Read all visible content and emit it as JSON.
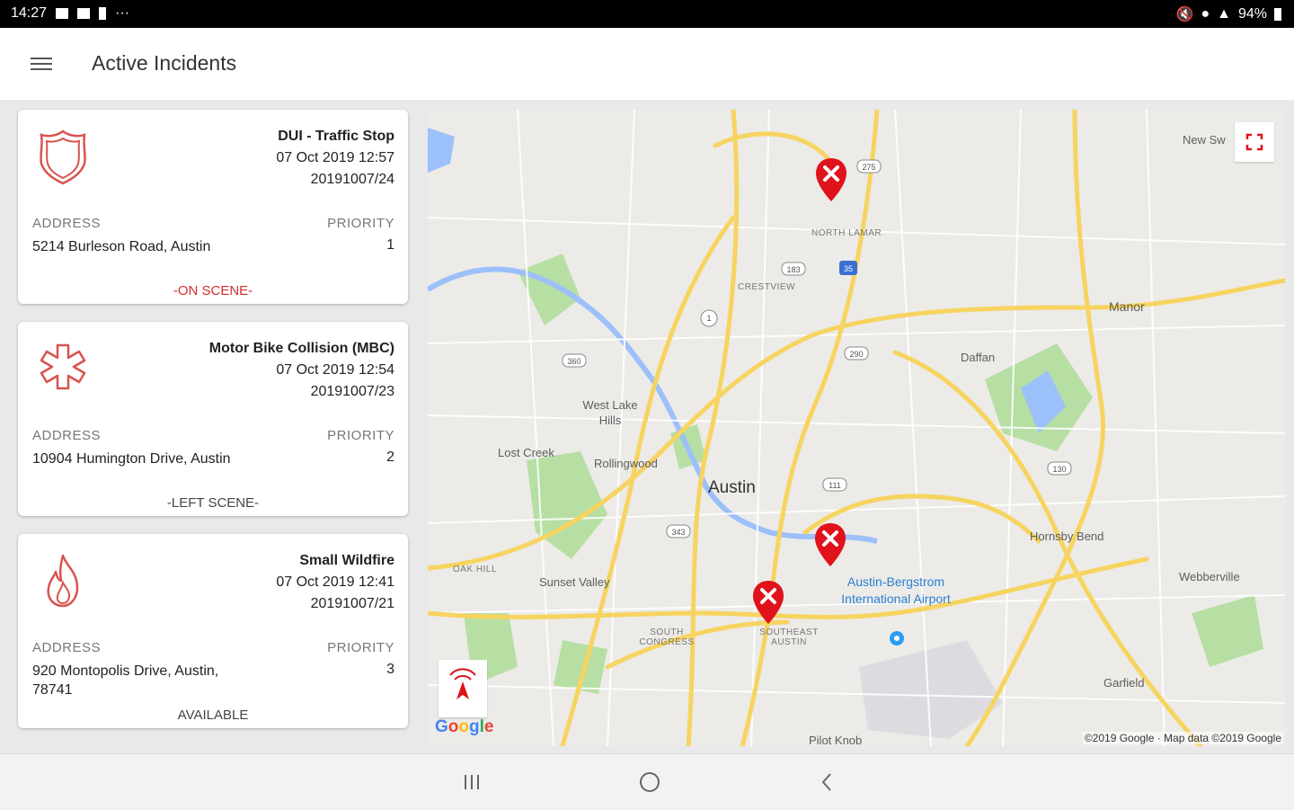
{
  "status_bar": {
    "time": "14:27",
    "more": "···",
    "battery": "94%"
  },
  "app_bar": {
    "title": "Active Incidents",
    "menu_icon": "menu-icon"
  },
  "incidents": [
    {
      "title": "DUI - Traffic Stop",
      "datetime": "07 Oct 2019 12:57",
      "id": "20191007/24",
      "address_label": "ADDRESS",
      "address": "5214  Burleson Road, Austin",
      "priority_label": "PRIORITY",
      "priority": "1",
      "status": "-ON SCENE-",
      "icon": "police-badge-icon",
      "status_color": "#d32f2f"
    },
    {
      "title": "Motor Bike Collision (MBC)",
      "datetime": "07 Oct 2019 12:54",
      "id": "20191007/23",
      "address_label": "ADDRESS",
      "address": "10904  Humington Drive, Austin",
      "priority_label": "PRIORITY",
      "priority": "2",
      "status": "-LEFT SCENE-",
      "icon": "ems-star-icon",
      "status_color": "#444444"
    },
    {
      "title": "Small Wildfire",
      "datetime": "07 Oct 2019 12:41",
      "id": "20191007/21",
      "address_label": "ADDRESS",
      "address": "920  Montopolis Drive, Austin, 78741",
      "priority_label": "PRIORITY",
      "priority": "3",
      "status": "AVAILABLE",
      "icon": "fire-icon",
      "status_color": "#444444"
    }
  ],
  "map": {
    "places": {
      "new_sweden": "New Sw",
      "north_lamar": "NORTH LAMAR",
      "crestview": "CRESTVIEW",
      "manor": "Manor",
      "daffan": "Daffan",
      "west_lake_hills": "West Lake Hills",
      "lost_creek": "Lost Creek",
      "rollingwood": "Rollingwood",
      "austin": "Austin",
      "hornsby_bend": "Hornsby Bend",
      "webberville": "Webberville",
      "oak_hill": "OAK HILL",
      "sunset_valley": "Sunset Valley",
      "south_congress": "SOUTH CONGRESS",
      "southeast_austin": "SOUTHEAST AUSTIN",
      "airport": "Austin-Bergstrom International Airport",
      "garfield": "Garfield",
      "pilot_knob": "Pilot Knob"
    },
    "road_shields": [
      "275",
      "183",
      "35",
      "1",
      "360",
      "290",
      "111",
      "343",
      "130"
    ],
    "google_logo": [
      "G",
      "o",
      "o",
      "g",
      "l",
      "e"
    ],
    "copyright": "©2019 Google · Map data ©2019 Google",
    "marker_color": "#e0121b",
    "colors": {
      "road_major": "#f7d460",
      "road_minor": "#ffffff",
      "water": "#9cc0f9",
      "park": "#b7dfa3"
    }
  },
  "nav_bar": {
    "recents": "recents-icon",
    "home": "home-icon",
    "back": "back-icon"
  }
}
